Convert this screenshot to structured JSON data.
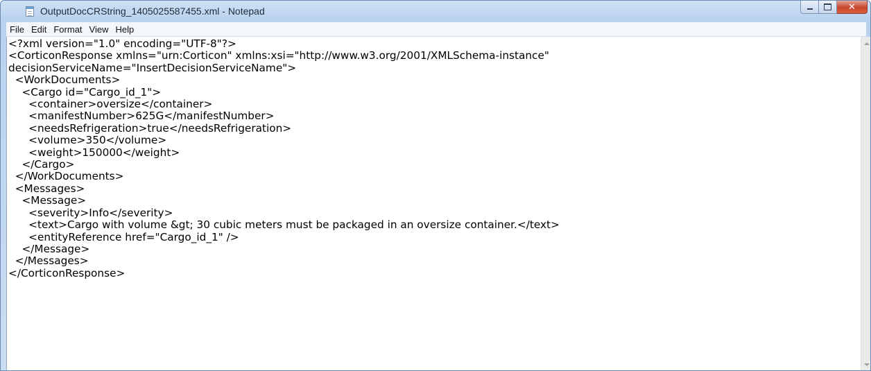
{
  "window": {
    "title": "OutputDocCRString_1405025587455.xml - Notepad",
    "icon": "notepad-icon"
  },
  "menu": {
    "items": [
      "File",
      "Edit",
      "Format",
      "View",
      "Help"
    ]
  },
  "editor": {
    "lines": [
      "<?xml version=\"1.0\" encoding=\"UTF-8\"?>",
      "<CorticonResponse xmlns=\"urn:Corticon\" xmlns:xsi=\"http://www.w3.org/2001/XMLSchema-instance\"",
      "decisionServiceName=\"InsertDecisionServiceName\">",
      "  <WorkDocuments>",
      "    <Cargo id=\"Cargo_id_1\">",
      "      <container>oversize</container>",
      "      <manifestNumber>625G</manifestNumber>",
      "      <needsRefrigeration>true</needsRefrigeration>",
      "      <volume>350</volume>",
      "      <weight>150000</weight>",
      "    </Cargo>",
      "  </WorkDocuments>",
      "  <Messages>",
      "    <Message>",
      "      <severity>Info</severity>",
      "      <text>Cargo with volume &gt; 30 cubic meters must be packaged in an oversize container.</text>",
      "      <entityReference href=\"Cargo_id_1\" />",
      "    </Message>",
      "  </Messages>",
      "</CorticonResponse>"
    ]
  }
}
